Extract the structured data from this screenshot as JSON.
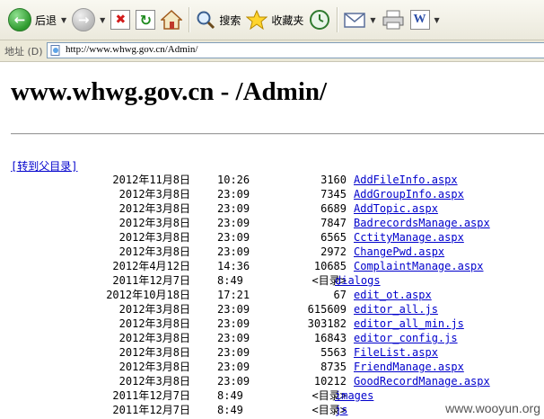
{
  "toolbar": {
    "back_label": "后退",
    "search_label": "搜索",
    "favorites_label": "收藏夹"
  },
  "address_bar": {
    "label": "地址 (D)",
    "url": "http://www.whwg.gov.cn/Admin/"
  },
  "page": {
    "title": "www.whwg.gov.cn - /Admin/",
    "parent_link": "[转到父目录]",
    "dir_marker": "<目录>"
  },
  "listing": [
    {
      "date": "2012年11月8日",
      "time": "10:26",
      "size": "3160",
      "name": "AddFileInfo.aspx"
    },
    {
      "date": "2012年3月8日",
      "time": "23:09",
      "size": "7345",
      "name": "AddGroupInfo.aspx"
    },
    {
      "date": "2012年3月8日",
      "time": "23:09",
      "size": "6689",
      "name": "AddTopic.aspx"
    },
    {
      "date": "2012年3月8日",
      "time": "23:09",
      "size": "7847",
      "name": "BadrecordsManage.aspx"
    },
    {
      "date": "2012年3月8日",
      "time": "23:09",
      "size": "6565",
      "name": "CctityManage.aspx"
    },
    {
      "date": "2012年3月8日",
      "time": "23:09",
      "size": "2972",
      "name": "ChangePwd.aspx"
    },
    {
      "date": "2012年4月12日",
      "time": "14:36",
      "size": "10685",
      "name": "ComplaintManage.aspx"
    },
    {
      "date": "2011年12月7日",
      "time": "8:49",
      "size": "<目录>",
      "name": "dialogs",
      "is_dir": true
    },
    {
      "date": "2012年10月18日",
      "time": "17:21",
      "size": "67",
      "name": "edit_ot.aspx"
    },
    {
      "date": "2012年3月8日",
      "time": "23:09",
      "size": "615609",
      "name": "editor_all.js"
    },
    {
      "date": "2012年3月8日",
      "time": "23:09",
      "size": "303182",
      "name": "editor_all_min.js"
    },
    {
      "date": "2012年3月8日",
      "time": "23:09",
      "size": "16843",
      "name": "editor_config.js"
    },
    {
      "date": "2012年3月8日",
      "time": "23:09",
      "size": "5563",
      "name": "FileList.aspx"
    },
    {
      "date": "2012年3月8日",
      "time": "23:09",
      "size": "8735",
      "name": "FriendManage.aspx"
    },
    {
      "date": "2012年3月8日",
      "time": "23:09",
      "size": "10212",
      "name": "GoodRecordManage.aspx"
    },
    {
      "date": "2011年12月7日",
      "time": "8:49",
      "size": "<目录>",
      "name": "images",
      "is_dir": true
    },
    {
      "date": "2011年12月7日",
      "time": "8:49",
      "size": "<目录>",
      "name": "js",
      "is_dir": true
    }
  ],
  "watermark": "www.wooyun.org",
  "colors": {
    "link": "#0000cc",
    "toolbar_bg": "#ece9d8",
    "back_green": "#2e9a2e"
  },
  "icons": [
    "back-icon",
    "forward-icon",
    "stop-icon",
    "refresh-icon",
    "home-icon",
    "search-icon",
    "favorites-star-icon",
    "history-icon",
    "mail-icon",
    "print-icon",
    "edit-word-icon",
    "page-icon"
  ]
}
